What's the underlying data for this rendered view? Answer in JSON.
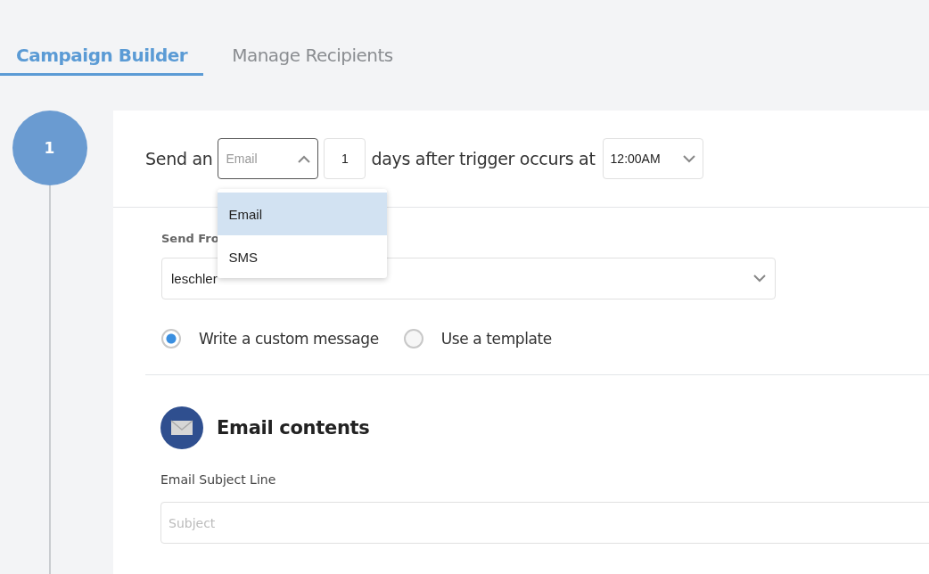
{
  "tabs": [
    {
      "label": "Campaign Builder",
      "selected": true
    },
    {
      "label": "Manage Recipients",
      "selected": false
    }
  ],
  "step": {
    "number": "1"
  },
  "trigger": {
    "prefix": "Send an",
    "channel_select": {
      "value": "Email",
      "expanded": true
    },
    "days": "1",
    "middle": "days after trigger occurs at",
    "time_select": {
      "value": "12:00AM",
      "expanded": false
    }
  },
  "channel_options": [
    {
      "label": "Email",
      "selected": true
    },
    {
      "label": "SMS",
      "selected": false
    }
  ],
  "send_from": {
    "label": "Send Fro",
    "value": "leschler"
  },
  "message_type": [
    {
      "label": "Write a custom message",
      "selected": true
    },
    {
      "label": "Use a template",
      "selected": false
    }
  ],
  "email_contents": {
    "title": "Email contents",
    "subject_label": "Email Subject Line",
    "subject_placeholder": "Subject"
  }
}
